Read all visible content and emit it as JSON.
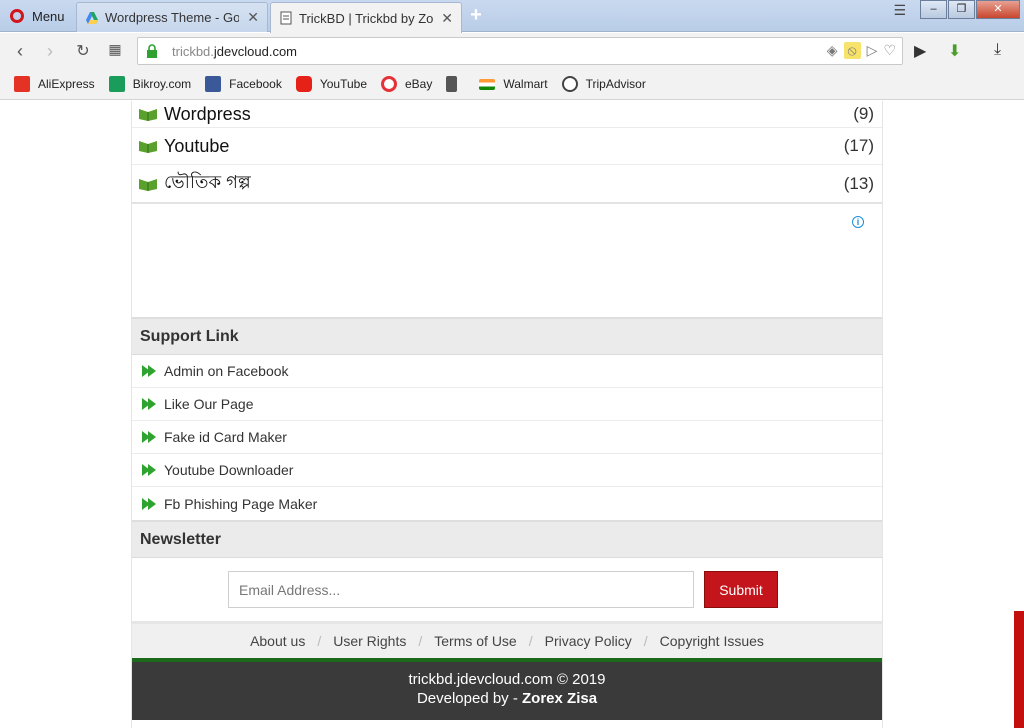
{
  "browser": {
    "menu_label": "Menu",
    "tabs": [
      {
        "title": "Wordpress Theme - Goog"
      },
      {
        "title": "TrickBD | Trickbd by Zorex"
      }
    ],
    "url_host_dim": "trickbd.",
    "url_host": "jdevcloud.com",
    "bookmarks": [
      {
        "label": "AliExpress",
        "icon": "aliexpress-icon",
        "color": "#e43225"
      },
      {
        "label": "Bikroy.com",
        "icon": "bikroy-icon",
        "color": "#1a9c5b"
      },
      {
        "label": "Facebook",
        "icon": "facebook-icon",
        "color": "#3b5998"
      },
      {
        "label": "YouTube",
        "icon": "youtube-icon",
        "color": "#e62117"
      },
      {
        "label": "eBay",
        "icon": "ebay-icon",
        "color": "#e53238"
      },
      {
        "label": "",
        "icon": "document-icon",
        "color": "#555555"
      },
      {
        "label": "Walmart",
        "icon": "india-flag-icon",
        "color": "#ff9933"
      },
      {
        "label": "TripAdvisor",
        "icon": "tripadvisor-icon",
        "color": "#444444"
      }
    ]
  },
  "categories": [
    {
      "name": "Wordpress",
      "count": "(9)"
    },
    {
      "name": "Youtube",
      "count": "(17)"
    },
    {
      "name": "ভৌতিক গল্প",
      "count": "(13)"
    }
  ],
  "ad": {
    "info": "i"
  },
  "support": {
    "title": "Support Link",
    "links": [
      "Admin on Facebook",
      "Like Our Page",
      "Fake id Card Maker",
      "Youtube Downloader",
      "Fb Phishing Page Maker"
    ]
  },
  "newsletter": {
    "title": "Newsletter",
    "placeholder": "Email Address...",
    "submit_label": "Submit"
  },
  "footer": {
    "links": [
      "About us",
      "User Rights",
      "Terms of Use",
      "Privacy Policy",
      "Copyright Issues"
    ],
    "copyright": "trickbd.jdevcloud.com © 2019",
    "developed_prefix": "Developed by - ",
    "developer": "Zorex Zisa"
  },
  "colors": {
    "accent_red": "#c4151c",
    "footer_dark": "#3a3a3a",
    "footer_green": "#1b6a1b"
  }
}
